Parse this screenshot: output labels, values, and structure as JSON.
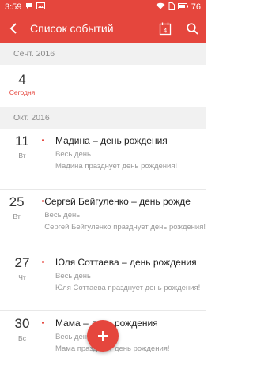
{
  "status_bar": {
    "time": "3:59",
    "battery": "76"
  },
  "app_bar": {
    "title": "Список событий",
    "calendar_day": "4"
  },
  "sections": [
    {
      "month": "Сент. 2016",
      "today": {
        "day": "4",
        "label": "Сегодня"
      }
    },
    {
      "month": "Окт. 2016",
      "events": [
        {
          "day": "11",
          "weekday": "Вт",
          "title": "Мадина – день рождения",
          "time": "Весь день",
          "desc": "Мадина празднует день рождения!"
        },
        {
          "day": "25",
          "weekday": "Вт",
          "title": "Сергей Бейгуленко – день рожде",
          "time": "Весь день",
          "desc": "Сергей Бейгуленко празднует день рождения!"
        },
        {
          "day": "27",
          "weekday": "Чт",
          "title": "Юля Соттаева – день рождения",
          "time": "Весь день",
          "desc": "Юля Соттаева празднует день рождения!"
        },
        {
          "day": "30",
          "weekday": "Вс",
          "title": "Мама – день рождения",
          "time": "Весь день",
          "desc": "Мама празднует день рождения!"
        }
      ]
    }
  ],
  "colors": {
    "accent": "#e5463d",
    "header_bg": "#f1f1f1"
  },
  "fab": {
    "icon": "plus-icon"
  }
}
